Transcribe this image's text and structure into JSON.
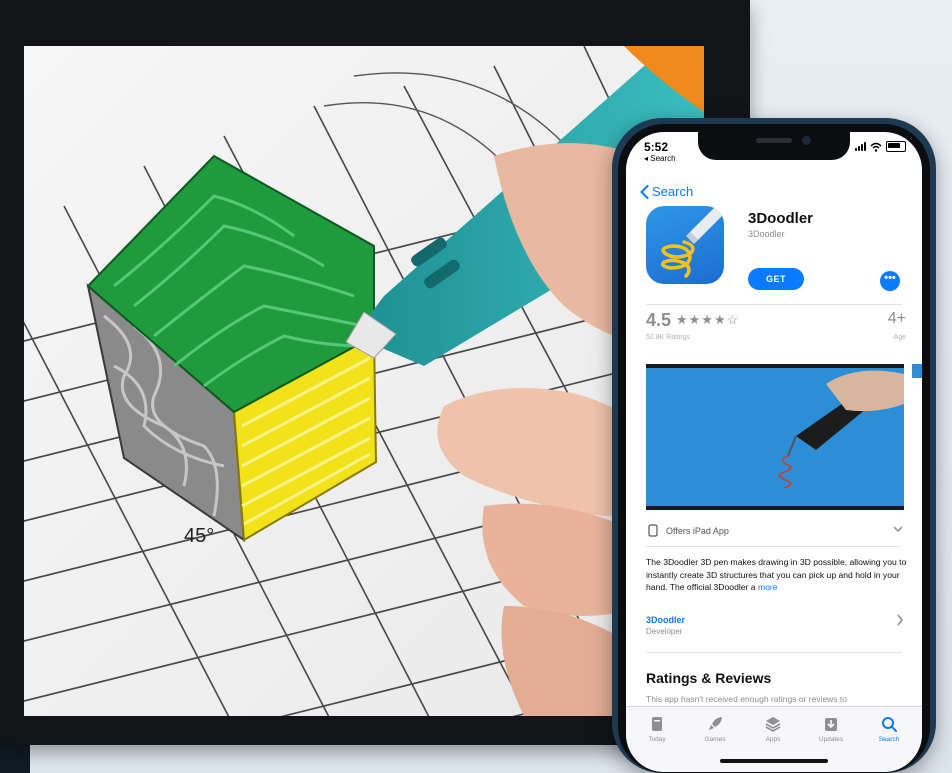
{
  "phone": {
    "status": {
      "time": "5:52",
      "back_app": "◂ Search"
    },
    "nav": {
      "back_label": "Search"
    },
    "app": {
      "name": "3Doodler",
      "developer": "3Doodler",
      "get_label": "GET",
      "more_label": "•••"
    },
    "rating": {
      "value": "4.5",
      "stars": "★★★★☆",
      "count_label": "52.8K Ratings",
      "age": "4+",
      "age_label": "Age"
    },
    "offers_label": "Offers iPad App",
    "description": "The 3Doodler 3D pen makes drawing in 3D possible, allowing you to instantly create 3D structures that you can pick up and hold in your hand. The official 3Doodler a",
    "description_more": "more",
    "developer_section": {
      "link": "3Doodler",
      "role": "Developer"
    },
    "ratings_section": {
      "title": "Ratings & Reviews",
      "note": "This app hasn't received enough ratings or reviews to"
    },
    "tabs": [
      {
        "label": "Today",
        "icon": "today-icon",
        "active": false
      },
      {
        "label": "Games",
        "icon": "rocket-icon",
        "active": false
      },
      {
        "label": "Apps",
        "icon": "layers-icon",
        "active": false
      },
      {
        "label": "Updates",
        "icon": "download-icon",
        "active": false
      },
      {
        "label": "Search",
        "icon": "search-icon",
        "active": true
      }
    ]
  },
  "tablet": {
    "angle_label": "45°"
  },
  "colors": {
    "accent": "#0a7aff",
    "frame": "#1e3a53",
    "cube_top": "#1f9a3c",
    "cube_side": "#f2e21a",
    "pen": "#2aa3a6"
  }
}
